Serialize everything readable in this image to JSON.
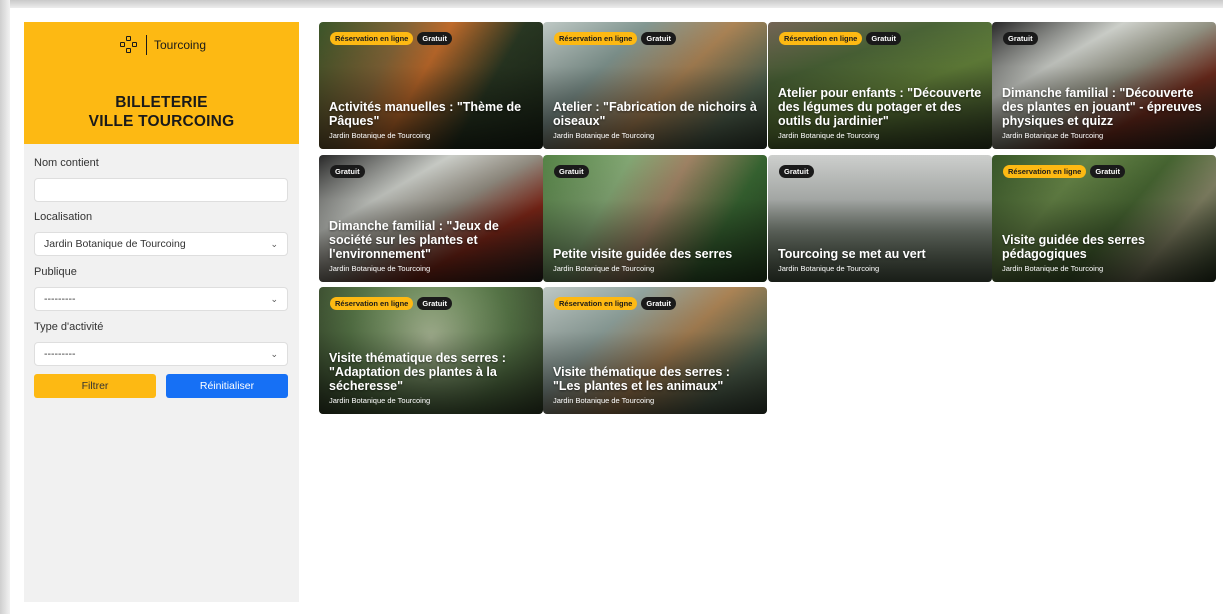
{
  "brand": {
    "logo_text": "Tourcoing",
    "title_line1": "BILLETERIE",
    "title_line2": "VILLE TOURCOING"
  },
  "filters": {
    "name_label": "Nom contient",
    "name_value": "",
    "location_label": "Localisation",
    "location_value": "Jardin Botanique de Tourcoing",
    "public_label": "Publique",
    "public_value": "---------",
    "type_label": "Type d'activité",
    "type_value": "---------",
    "filter_button": "Filtrer",
    "reset_button": "Réinitialiser"
  },
  "badges": {
    "online": "Réservation en ligne",
    "free": "Gratuit"
  },
  "events": [
    {
      "title": "Activités manuelles : \"Thème de Pâques\"",
      "location": "Jardin Botanique de Tourcoing",
      "online": true,
      "free": true
    },
    {
      "title": "Atelier : \"Fabrication de nichoirs à oiseaux\"",
      "location": "Jardin Botanique de Tourcoing",
      "online": true,
      "free": true
    },
    {
      "title": "Atelier pour enfants : \"Découverte des légumes du potager et des outils du jardinier\"",
      "location": "Jardin Botanique de Tourcoing",
      "online": true,
      "free": true
    },
    {
      "title": "Dimanche familial : \"Découverte des plantes en jouant\" - épreuves physiques et quizz",
      "location": "Jardin Botanique de Tourcoing",
      "online": false,
      "free": true
    },
    {
      "title": "Dimanche familial : \"Jeux de société sur les plantes et l'environnement\"",
      "location": "Jardin Botanique de Tourcoing",
      "online": false,
      "free": true
    },
    {
      "title": "Petite visite guidée des serres",
      "location": "Jardin Botanique de Tourcoing",
      "online": false,
      "free": true
    },
    {
      "title": "Tourcoing se met au vert",
      "location": "Jardin Botanique de Tourcoing",
      "online": false,
      "free": true
    },
    {
      "title": "Visite guidée des serres pédagogiques",
      "location": "Jardin Botanique de Tourcoing",
      "online": true,
      "free": true
    },
    {
      "title": "Visite thématique des serres : \"Adaptation des plantes à la sécheresse\"",
      "location": "Jardin Botanique de Tourcoing",
      "online": true,
      "free": true
    },
    {
      "title": "Visite thématique des serres : \"Les plantes et les animaux\"",
      "location": "Jardin Botanique de Tourcoing",
      "online": true,
      "free": true
    }
  ],
  "colors": {
    "brand_yellow": "#fdb913",
    "reset_blue": "#1670f5",
    "badge_dark": "#1a1a1a"
  },
  "icons": {
    "logo": "tourcoing-logo-icon",
    "select": "chevron-down-icon"
  }
}
